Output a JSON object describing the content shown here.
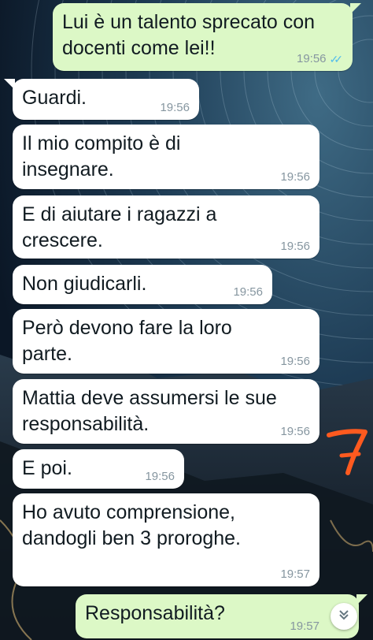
{
  "messages": [
    {
      "direction": "out",
      "text": "Lui è un talento sprecato con docenti come lei!!",
      "time": "19:56",
      "status": "read"
    },
    {
      "direction": "in",
      "text": "Guardi.",
      "time": "19:56"
    },
    {
      "direction": "in",
      "text": "Il mio compito è di insegnare.",
      "time": "19:56"
    },
    {
      "direction": "in",
      "text": "E di aiutare i ragazzi a crescere.",
      "time": "19:56"
    },
    {
      "direction": "in",
      "text": "Non giudicarli.",
      "time": "19:56"
    },
    {
      "direction": "in",
      "text": "Però devono fare la loro parte.",
      "time": "19:56"
    },
    {
      "direction": "in",
      "text": "Mattia deve assumersi le sue responsabilità.",
      "time": "19:56"
    },
    {
      "direction": "in",
      "text": "E poi.",
      "time": "19:56"
    },
    {
      "direction": "in",
      "text": "Ho avuto comprensione, dandogli ben 3 proroghe.",
      "time": "19:57"
    },
    {
      "direction": "out",
      "text": "Responsabilità?",
      "time": "19:57"
    }
  ],
  "annotation": {
    "number": "7",
    "color": "#ff5a1f"
  },
  "icons": {
    "read_receipt": "double-check-icon",
    "scroll_down": "double-chevron-down-icon"
  },
  "colors": {
    "incoming_bubble": "#ffffff",
    "outgoing_bubble": "#dcf8c6",
    "read_tick": "#53bdeb"
  }
}
